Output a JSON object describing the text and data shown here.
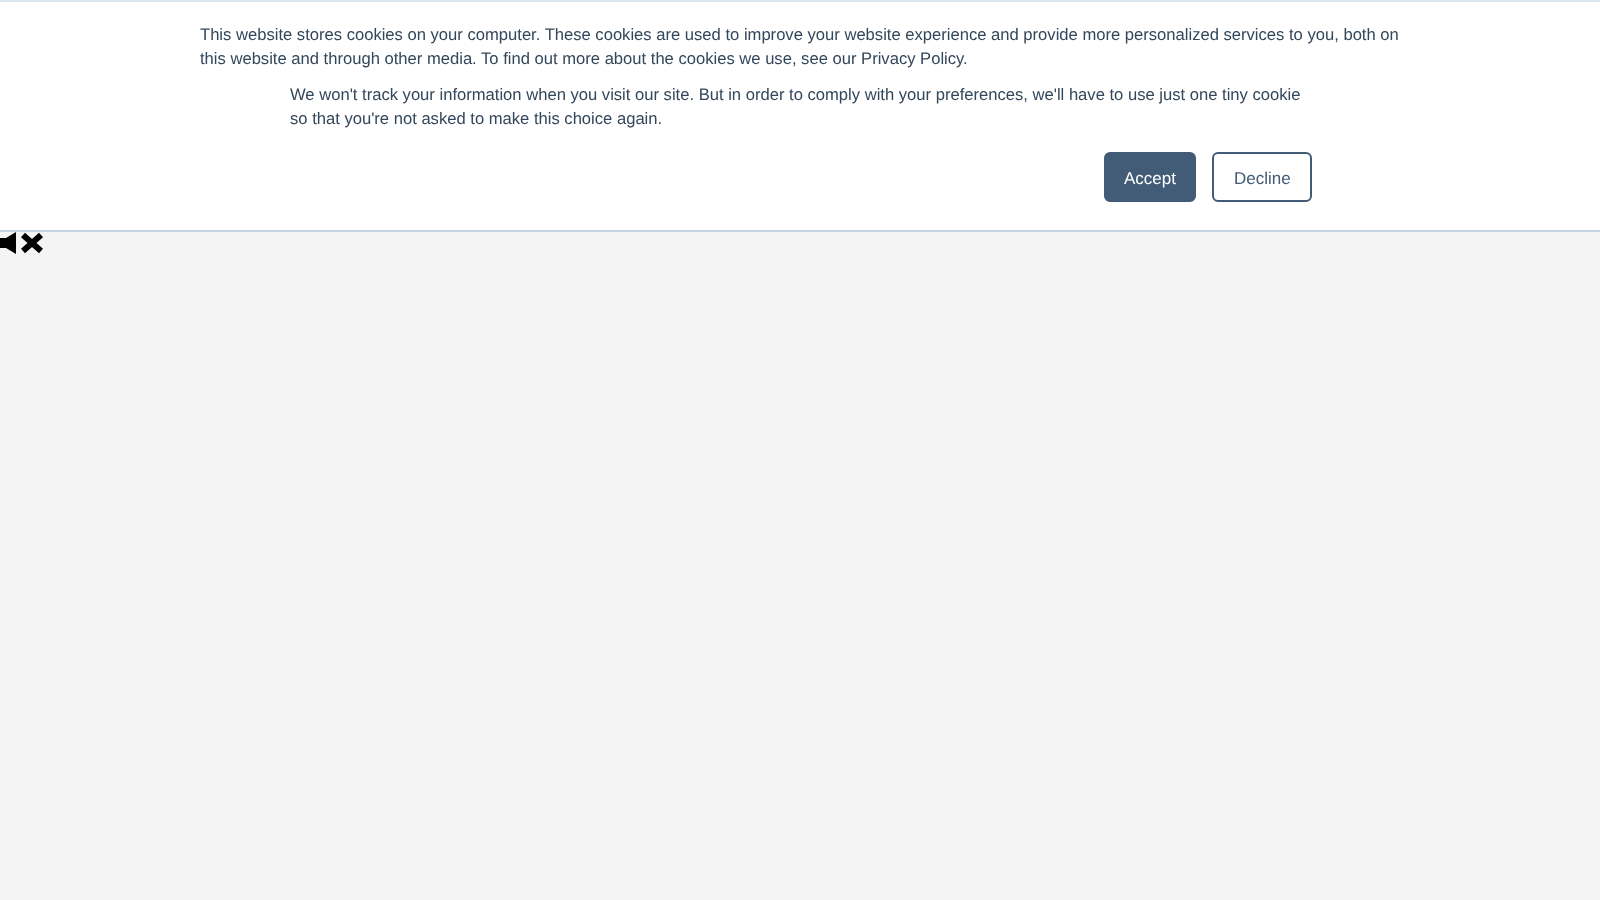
{
  "cookie_banner": {
    "message": "This website stores cookies on your computer. These cookies are used to improve your website experience and provide more personalized services to you, both on this website and through other media. To find out more about the cookies we use, see our Privacy Policy.",
    "note": "We won't track your information when you visit our site. But in order to comply with your preferences, we'll have to use just one tiny cookie so that you're not asked to make this choice again.",
    "buttons": [
      {
        "label": "Accept",
        "kind": "primary"
      },
      {
        "label": "Decline",
        "kind": "secondary"
      }
    ]
  }
}
